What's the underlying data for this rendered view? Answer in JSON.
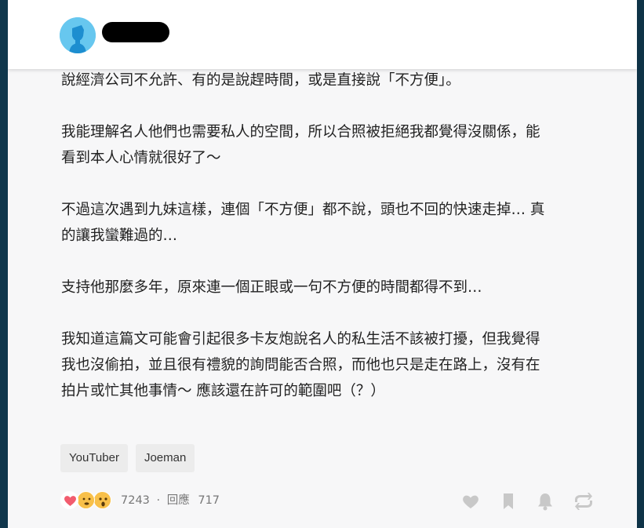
{
  "post": {
    "author_name": "",
    "paragraphs": [
      [
        "說經濟公司不允許、有的是說趕時間，或是直接說「不方便」。"
      ],
      [
        "我能理解名人他們也需要私人的空間，所以合照被拒絕我都覺得沒關係，能",
        "看到本人心情就很好了～"
      ],
      [
        "不過這次遇到九妹這樣，連個「不方便」都不說，頭也不回的快速走掉… 真",
        "的讓我蠻難過的…"
      ],
      [
        "支持他那麼多年，原來連一個正眼或一句不方便的時間都得不到…"
      ],
      [
        "我知道這篇文可能會引起很多卡友炮說名人的私生活不該被打擾，但我覺得",
        "我也沒偷拍，並且很有禮貌的詢問能否合照，而他也只是走在路上，沒有在",
        "拍片或忙其他事情～ 應該還在許可的範圍吧（？）"
      ]
    ],
    "tags": [
      "YouTuber",
      "Joeman"
    ],
    "reaction_count": "7243",
    "separator": "·",
    "reply_label": "回應",
    "reply_count": "717",
    "reactions": [
      "heart-reaction",
      "surprised-reaction",
      "shocked-reaction"
    ],
    "actions": [
      "like-icon",
      "bookmark-icon",
      "notification-bell-icon",
      "share-icon"
    ]
  },
  "colors": {
    "background_frame": "#0e3347",
    "panel": "#f7f7f8",
    "avatar": "#67c7ef",
    "heart": "#f25c6e",
    "emoji": "#f8c04a",
    "action_icon": "#c8c8c8",
    "text": "#222222",
    "meta_text": "#777777",
    "tag_bg": "#ececec"
  }
}
